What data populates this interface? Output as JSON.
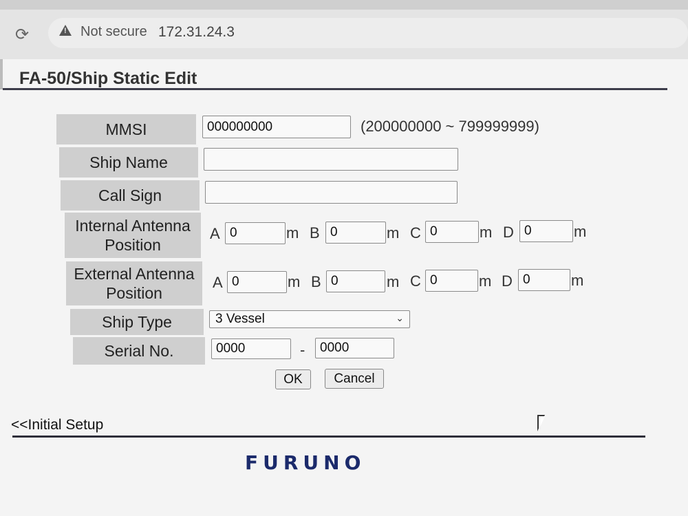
{
  "browser": {
    "security_label": "Not secure",
    "url": "172.31.24.3"
  },
  "page": {
    "title": "FA-50/Ship Static Edit"
  },
  "form": {
    "mmsi": {
      "label": "MMSI",
      "value": "000000000",
      "range": "(200000000 ~ 799999999)"
    },
    "ship_name": {
      "label": "Ship Name",
      "value": ""
    },
    "call_sign": {
      "label": "Call Sign",
      "value": ""
    },
    "internal_antenna": {
      "label_line1": "Internal Antenna",
      "label_line2": "Position",
      "a": "0",
      "b": "0",
      "c": "0",
      "d": "0"
    },
    "external_antenna": {
      "label_line1": "External Antenna",
      "label_line2": "Position",
      "a": "0",
      "b": "0",
      "c": "0",
      "d": "0"
    },
    "dim_letters": {
      "a": "A",
      "b": "B",
      "c": "C",
      "d": "D"
    },
    "unit": "m",
    "ship_type": {
      "label": "Ship Type",
      "value": "3 Vessel"
    },
    "serial": {
      "label": "Serial No.",
      "part1": "0000",
      "separator": "-",
      "part2": "0000"
    }
  },
  "buttons": {
    "ok": "OK",
    "cancel": "Cancel"
  },
  "footer": {
    "back_link": "<<Initial Setup",
    "brand": "FURUNO"
  },
  "colors": {
    "brand": "#1b2a6b",
    "label_bg": "#cfcfcf"
  }
}
